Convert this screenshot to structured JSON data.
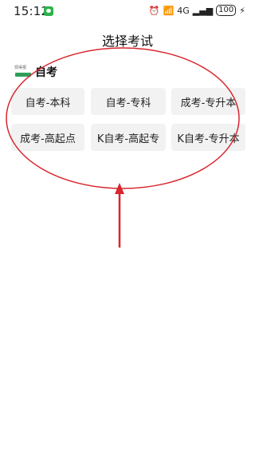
{
  "status_bar": {
    "time": "15:12",
    "network": "4G",
    "battery": "100"
  },
  "header": {
    "title": "选择考试"
  },
  "section": {
    "logo_text": "现得报",
    "title": "自考"
  },
  "exam_options": [
    {
      "label": "自考-本科"
    },
    {
      "label": "自考-专科"
    },
    {
      "label": "成考-专升本"
    },
    {
      "label": "成考-高起点"
    },
    {
      "label": "K自考-高起专"
    },
    {
      "label": "K自考-专升本"
    }
  ],
  "annotation": {
    "color": "#d7262d"
  }
}
